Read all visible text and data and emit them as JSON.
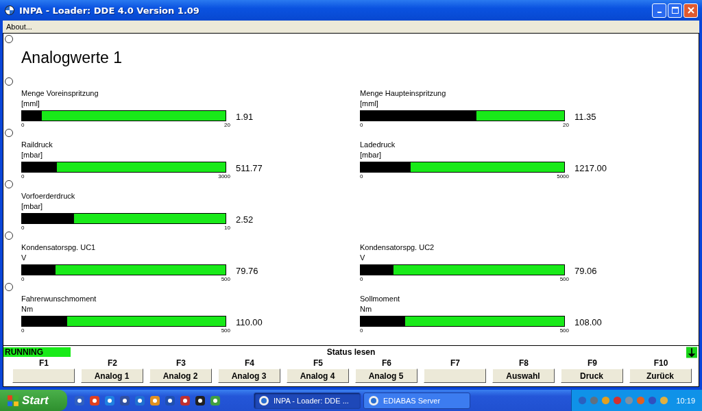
{
  "window": {
    "title": "INPA - Loader:  DDE 4.0 Version 1.09"
  },
  "menu": [
    "About..."
  ],
  "heading": "Analogwerte 1",
  "rows": [
    {
      "gauges": [
        {
          "name": "Menge Voreinspritzung",
          "unit": "[mml]",
          "level": 0.095,
          "value": "1.91",
          "min": "0",
          "max": "20"
        },
        {
          "name": "Menge Haupteinspritzung",
          "unit": "[mml]",
          "level": 0.567,
          "value": "11.35",
          "min": "0",
          "max": "20"
        }
      ]
    },
    {
      "gauges": [
        {
          "name": "Raildruck",
          "unit": "[mbar]",
          "level": 0.17,
          "value": "511.77",
          "min": "0",
          "max": "3000"
        },
        {
          "name": "Ladedruck",
          "unit": "[mbar]",
          "level": 0.243,
          "value": "1217.00",
          "min": "0",
          "max": "5000"
        }
      ]
    },
    {
      "gauges": [
        {
          "name": "Vorfoerderdruck",
          "unit": "[mbar]",
          "level": 0.252,
          "value": "2.52",
          "min": "0",
          "max": "10"
        }
      ]
    },
    {
      "gauges": [
        {
          "name": "Kondensatorspg. UC1",
          "unit": "V",
          "level": 0.16,
          "value": "79.76",
          "min": "0",
          "max": "500"
        },
        {
          "name": "Kondensatorspg. UC2",
          "unit": "V",
          "level": 0.158,
          "value": "79.06",
          "min": "0",
          "max": "500"
        }
      ]
    },
    {
      "gauges": [
        {
          "name": "Fahrerwunschmoment",
          "unit": "Nm",
          "level": 0.22,
          "value": "110.00",
          "min": "0",
          "max": "500"
        },
        {
          "name": "Sollmoment",
          "unit": "Nm",
          "level": 0.216,
          "value": "108.00",
          "min": "0",
          "max": "500"
        }
      ]
    }
  ],
  "status": {
    "state": "RUNNING",
    "title": "Status lesen"
  },
  "function_keys": [
    {
      "key": "F1"
    },
    {
      "key": "F2",
      "label": "Analog 1"
    },
    {
      "key": "F3",
      "label": "Analog 2"
    },
    {
      "key": "F4",
      "label": "Analog 3"
    },
    {
      "key": "F5",
      "label": "Analog 4"
    },
    {
      "key": "F6",
      "label": "Analog 5"
    },
    {
      "key": "F7"
    },
    {
      "key": "F8",
      "label": "Auswahl"
    },
    {
      "key": "F9",
      "label": "Druck"
    },
    {
      "key": "F10",
      "label": "Zurück"
    }
  ],
  "taskbar": {
    "start": "Start",
    "tasks": [
      {
        "label": "INPA - Loader:  DDE ...",
        "selected": true
      },
      {
        "label": "EDIABAS Server",
        "selected": false
      }
    ],
    "clock": "10:19"
  }
}
